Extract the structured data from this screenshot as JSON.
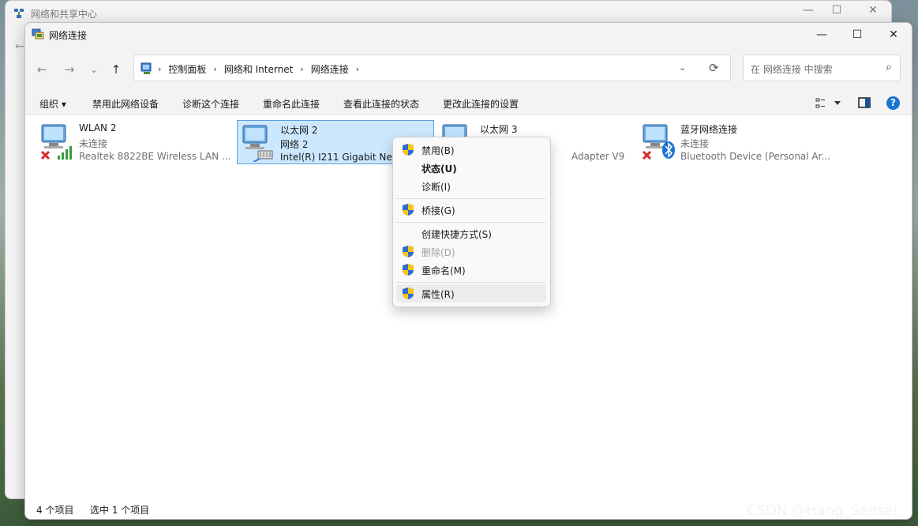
{
  "background_window": {
    "title": "网络和共享中心",
    "minimize": "—",
    "maximize": "☐",
    "close": "✕",
    "back": "←"
  },
  "window": {
    "title": "网络连接",
    "minimize": "—",
    "maximize": "☐",
    "close": "✕"
  },
  "nav": {
    "back": "←",
    "forward": "→",
    "recent": "⌄",
    "up": "↑",
    "breadcrumb": [
      "控制面板",
      "网络和 Internet",
      "网络连接"
    ],
    "dropdown": "⌄",
    "refresh": "⟳"
  },
  "search": {
    "placeholder": "在 网络连接 中搜索",
    "icon": "⌕"
  },
  "commands": {
    "organize": "组织 ▾",
    "disable": "禁用此网络设备",
    "diagnose": "诊断这个连接",
    "rename": "重命名此连接",
    "view_status": "查看此连接的状态",
    "change_settings": "更改此连接的设置",
    "help": "?"
  },
  "items": [
    {
      "name": "WLAN 2",
      "status": "未连接",
      "device": "Realtek 8822BE Wireless LAN ..."
    },
    {
      "name": "以太网 2",
      "status": "网络 2",
      "device": "Intel(R) I211 Gigabit Net"
    },
    {
      "name": "以太网 3",
      "status": "",
      "device": "Adapter V9"
    },
    {
      "name": "蓝牙网络连接",
      "status": "未连接",
      "device": "Bluetooth Device (Personal Ar..."
    }
  ],
  "context_menu": {
    "disable": "禁用(B)",
    "status": "状态(U)",
    "diagnose": "诊断(I)",
    "bridge": "桥接(G)",
    "shortcut": "创建快捷方式(S)",
    "delete": "删除(D)",
    "rename": "重命名(M)",
    "properties": "属性(R)"
  },
  "statusbar": {
    "count": "4 个项目",
    "selected": "选中 1 个项目"
  },
  "watermark": "CSDN @Hang_Sensei",
  "colors": {
    "selection": "#cce8ff",
    "selection_border": "#5ea0d9",
    "error_x": "#d92b2b",
    "shield_blue": "#2d6fc9",
    "shield_yellow": "#f5c518"
  }
}
